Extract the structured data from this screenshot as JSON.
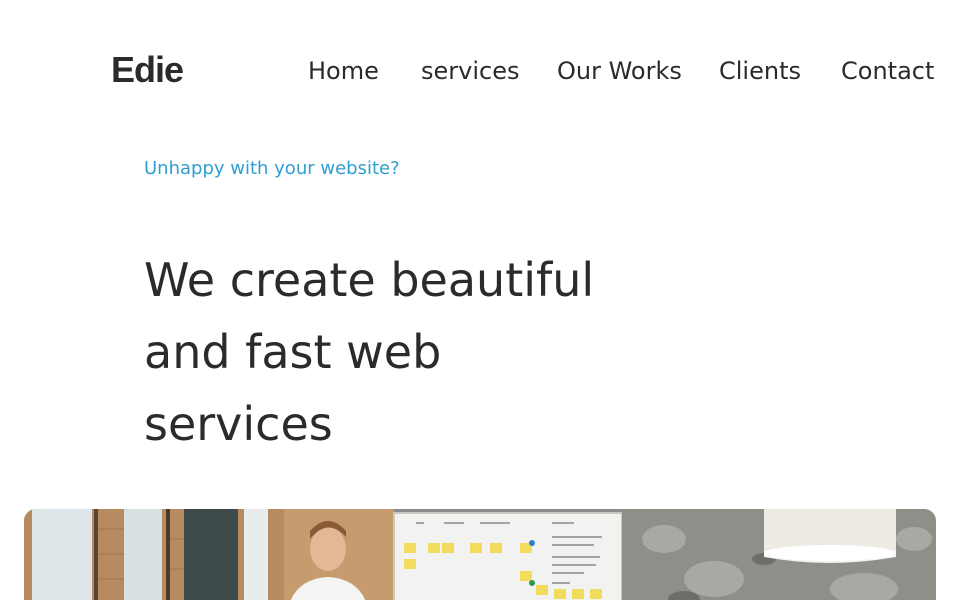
{
  "brand": {
    "logo_text": "Edie"
  },
  "nav": {
    "items": [
      {
        "label": "Home"
      },
      {
        "label": "services"
      },
      {
        "label": "Our Works"
      },
      {
        "label": "Clients"
      },
      {
        "label": "Contact"
      }
    ]
  },
  "hero": {
    "eyebrow": "Unhappy with your website?",
    "headline_lines": [
      "We create beautiful",
      "and fast web",
      "services"
    ],
    "image": {
      "description_icon": "office-whiteboard-photo",
      "colors": {
        "brick": "#b88a60",
        "whiteboard": "#f2f2f0",
        "sticky_note": "#f2dc5d",
        "concrete": "#8f8f8a"
      }
    }
  },
  "colors": {
    "accent": "#2e9fd0",
    "text": "#2b2b2b",
    "background": "#ffffff"
  }
}
